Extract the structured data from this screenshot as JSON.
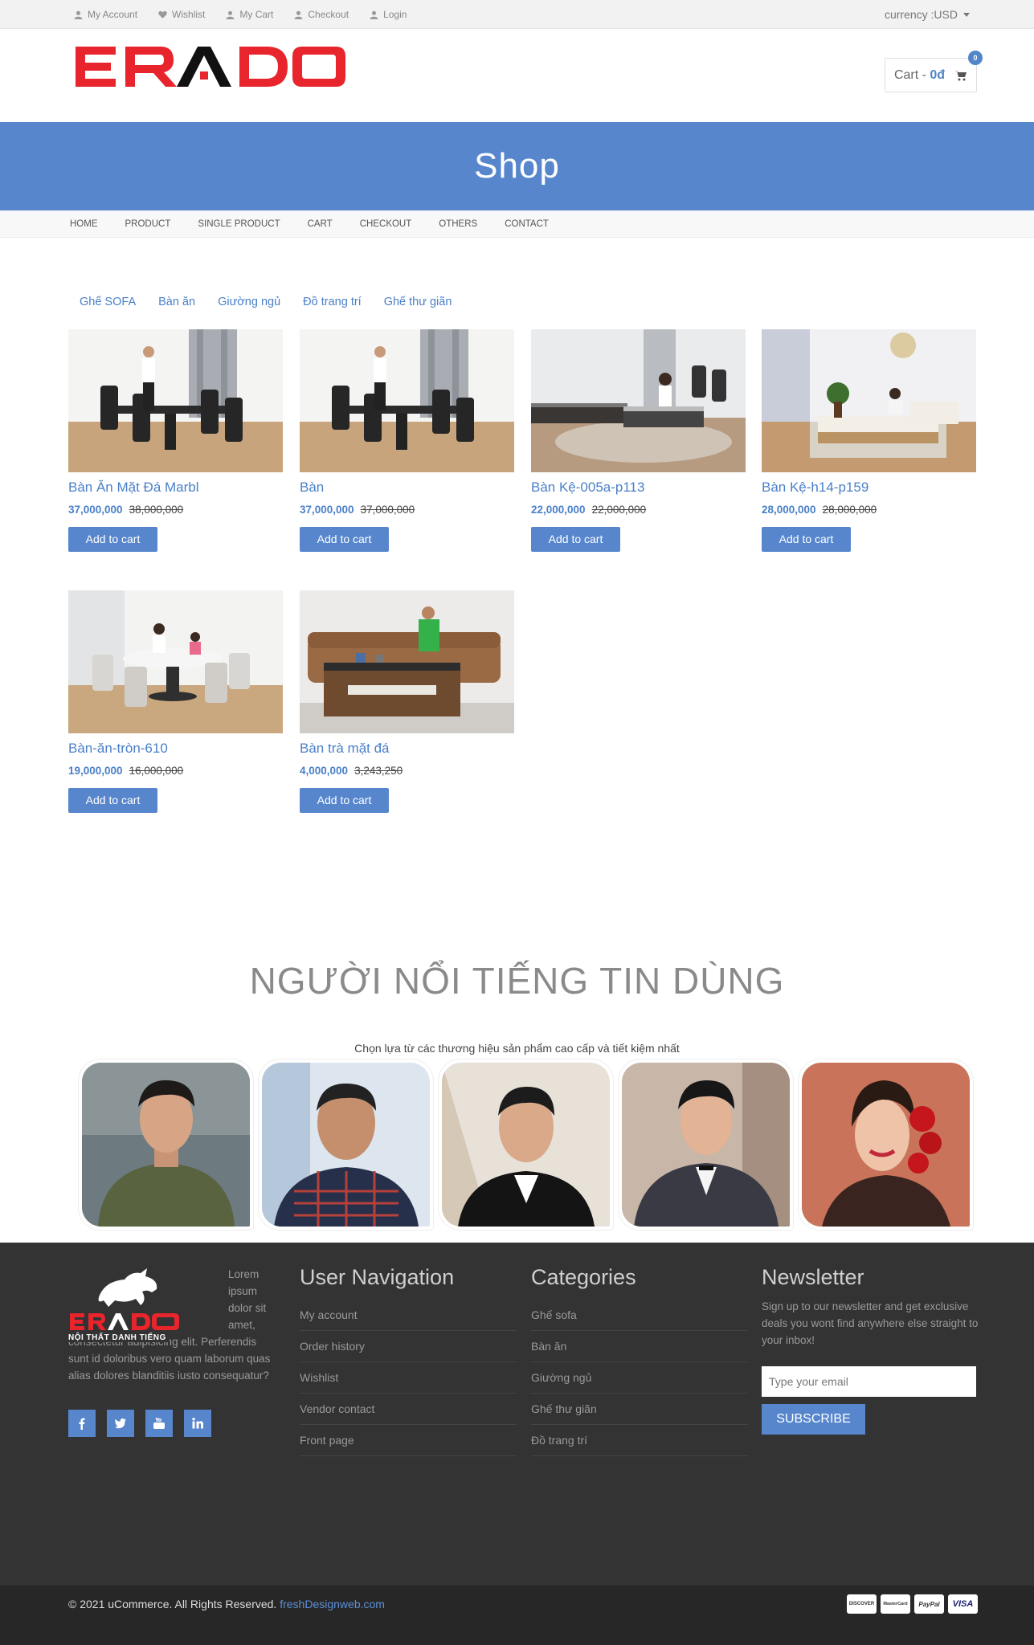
{
  "topbar": {
    "links": [
      {
        "label": "My Account",
        "icon": "user-icon"
      },
      {
        "label": "Wishlist",
        "icon": "heart-icon"
      },
      {
        "label": "My Cart",
        "icon": "user-icon"
      },
      {
        "label": "Checkout",
        "icon": "user-icon"
      },
      {
        "label": "Login",
        "icon": "lock-icon"
      }
    ],
    "currency": "currency :USD"
  },
  "header": {
    "logo_text": "ERADO",
    "cart_label": "Cart - ",
    "cart_amount": "0đ",
    "cart_count": "0"
  },
  "banner": {
    "title": "Shop"
  },
  "nav": {
    "items": [
      "HOME",
      "PRODUCT",
      "SINGLE PRODUCT",
      "CART",
      "CHECKOUT",
      "OTHERS",
      "CONTACT"
    ]
  },
  "categories": [
    "Ghế SOFA",
    "Bàn ăn",
    "Giường ngủ",
    "Đồ trang trí",
    "Ghế thư giãn"
  ],
  "products": [
    {
      "name": "Bàn Ăn Mặt Đá Marbl",
      "price": "37,000,000",
      "old_price": "38,000,000",
      "button": "Add to cart"
    },
    {
      "name": "Bàn",
      "price": "37,000,000",
      "old_price": "37,000,000",
      "button": "Add to cart"
    },
    {
      "name": "Bàn Kệ-005a-p113",
      "price": "22,000,000",
      "old_price": "22,000,000",
      "button": "Add to cart"
    },
    {
      "name": "Bàn Kệ-h14-p159",
      "price": "28,000,000",
      "old_price": "28,000,000",
      "button": "Add to cart"
    },
    {
      "name": "Bàn-ăn-tròn-610",
      "price": "19,000,000",
      "old_price": "16,000,000",
      "button": "Add to cart"
    },
    {
      "name": "Bàn trà mặt đá",
      "price": "4,000,000",
      "old_price": "3,243,250",
      "button": "Add to cart"
    }
  ],
  "celebrities": {
    "title": "NGƯỜI NỔI TIẾNG TIN DÙNG",
    "subtitle": "Chọn lựa từ các thương hiệu sản phẩm cao cấp và tiết kiệm nhất"
  },
  "footer": {
    "logo_tagline": "NỘI THẤT DANH TIẾNG",
    "about": "Lorem ipsum dolor sit amet, consectetur adipisicing elit. Perferendis sunt id doloribus vero quam laborum quas alias dolores blanditiis iusto consequatur?",
    "user_nav_title": "User Navigation",
    "user_nav": [
      "My account",
      "Order history",
      "Wishlist",
      "Vendor contact",
      "Front page"
    ],
    "categories_title": "Categories",
    "categories": [
      "Ghế sofa",
      "Bàn ăn",
      "Giường ngủ",
      "Ghế thư giãn",
      "Đồ trang trí"
    ],
    "newsletter_title": "Newsletter",
    "newsletter_desc": "Sign up to our newsletter and get exclusive deals you wont find anywhere else straight to your inbox!",
    "email_placeholder": "Type your email",
    "subscribe": "SUBSCRIBE",
    "copyright": "© 2021 uCommerce. All Rights Reserved. ",
    "copyright_link": "freshDesignweb.com",
    "payments": [
      "DISCOVER",
      "MasterCard",
      "PayPal",
      "VISA"
    ]
  },
  "colors": {
    "accent": "#5786cd",
    "link": "#4a80c8",
    "footer_bg": "#333333",
    "logo_red": "#e8242c"
  }
}
